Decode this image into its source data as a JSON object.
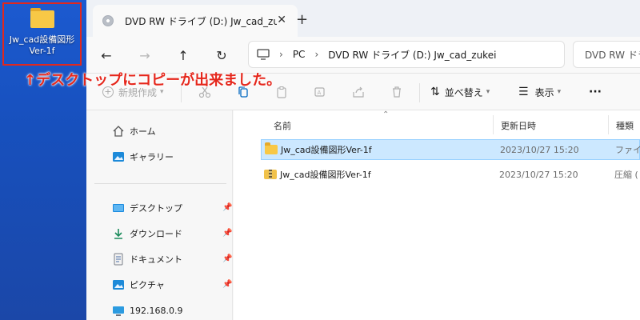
{
  "desktop": {
    "icon_label": "Jw_cad設備図形\nVer-1f",
    "annotation": "↑デスクトップにコピーが出来ました。"
  },
  "tab": {
    "title": "DVD RW ドライブ (D:) Jw_cad_zu",
    "close": "✕",
    "new_tab": "+"
  },
  "nav": {
    "back": "←",
    "forward": "→",
    "up": "↑",
    "refresh": "↻",
    "breadcrumb": [
      "PC",
      "DVD RW ドライブ (D:) Jw_cad_zukei"
    ],
    "breadcrumb_sep": "›",
    "search_text": "DVD RW ドライ"
  },
  "toolbar": {
    "new_label": "新規作成",
    "sort_label": "並べ替え",
    "view_label": "表示",
    "more_label": "···"
  },
  "sidebar": {
    "home": "ホーム",
    "gallery": "ギャラリー",
    "desktop": "デスクトップ",
    "downloads": "ダウンロード",
    "documents": "ドキュメント",
    "pictures": "ピクチャ",
    "network": "192.168.0.9",
    "pin": "📌"
  },
  "columns": {
    "name": "名前",
    "date": "更新日時",
    "type": "種類"
  },
  "files": [
    {
      "name": "Jw_cad設備図形Ver-1f",
      "date": "2023/10/27 15:20",
      "type": "ファイル",
      "icon": "folder-icon",
      "selected": true
    },
    {
      "name": "Jw_cad設備図形Ver-1f",
      "date": "2023/10/27 15:20",
      "type": "圧縮 (",
      "icon": "zip-folder-icon",
      "selected": false
    }
  ],
  "colors": {
    "accent": "#0067c0",
    "selection": "#cce8ff",
    "annotation": "#e5271c",
    "desktop": "#1a56c5"
  }
}
